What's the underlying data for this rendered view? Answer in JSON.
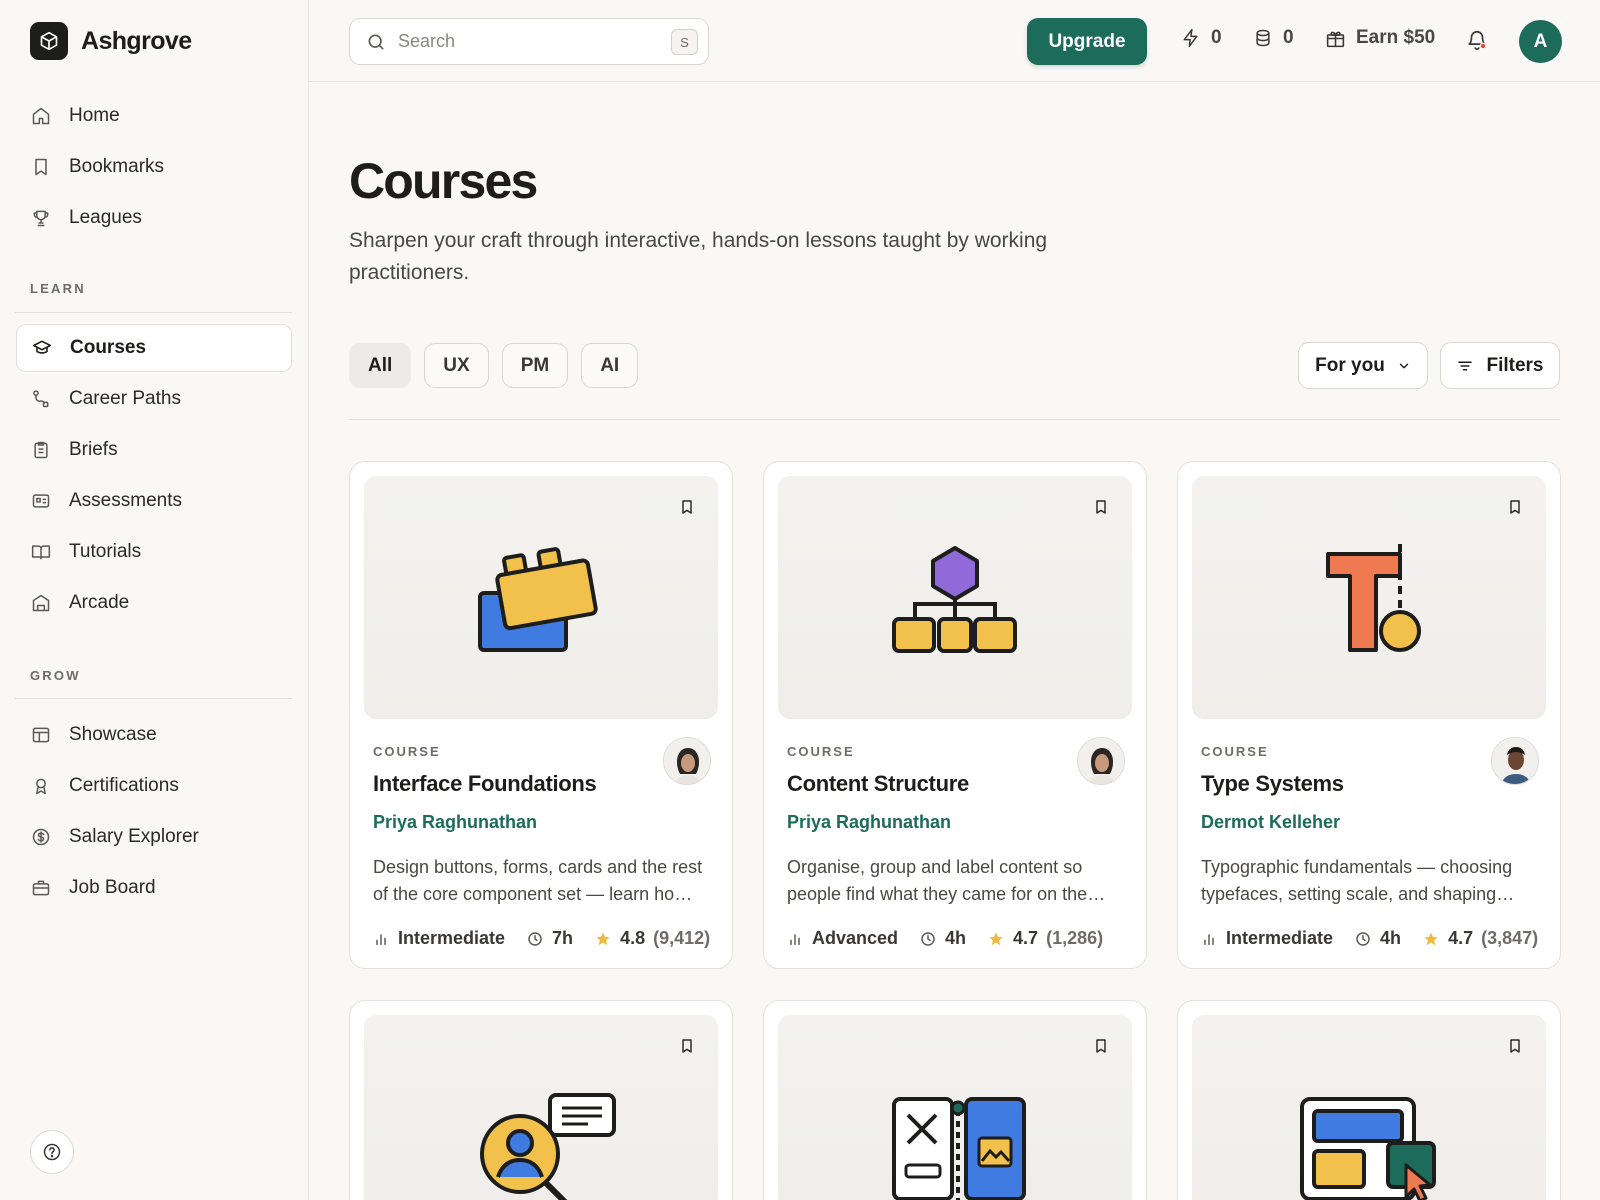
{
  "app": {
    "name": "Ashgrove"
  },
  "sidebar": {
    "primary": [
      {
        "label": "Home",
        "icon": "home-icon"
      },
      {
        "label": "Bookmarks",
        "icon": "bookmark-icon"
      },
      {
        "label": "Leagues",
        "icon": "trophy-icon"
      }
    ],
    "learn_label": "LEARN",
    "learn": [
      {
        "label": "Courses",
        "icon": "graduation-cap-icon",
        "active": true
      },
      {
        "label": "Career Paths",
        "icon": "route-icon"
      },
      {
        "label": "Briefs",
        "icon": "clipboard-icon"
      },
      {
        "label": "Assessments",
        "icon": "id-card-icon"
      },
      {
        "label": "Tutorials",
        "icon": "open-book-icon"
      },
      {
        "label": "Arcade",
        "icon": "arcade-icon"
      }
    ],
    "grow_label": "GROW",
    "grow": [
      {
        "label": "Showcase",
        "icon": "layout-icon"
      },
      {
        "label": "Certifications",
        "icon": "award-icon"
      },
      {
        "label": "Salary Explorer",
        "icon": "dollar-circle-icon"
      },
      {
        "label": "Job Board",
        "icon": "briefcase-icon"
      }
    ]
  },
  "topbar": {
    "search_placeholder": "Search",
    "search_shortcut": "S",
    "upgrade_label": "Upgrade",
    "energy_count": "0",
    "coins_count": "0",
    "earn_label": "Earn $50",
    "avatar_initial": "A"
  },
  "main": {
    "title": "Courses",
    "subtitle": "Sharpen your craft through interactive, hands-on lessons taught by working practitioners.",
    "chips": [
      "All",
      "UX",
      "PM",
      "AI"
    ],
    "active_chip": "All",
    "sort_label": "For you",
    "filters_label": "Filters"
  },
  "courses": [
    {
      "kicker": "COURSE",
      "title": "Interface Foundations",
      "author": "Priya Raghunathan",
      "description": "Design buttons, forms, cards and the rest of the core component set — learn how to build interfaces that feel consistent.",
      "level": "Intermediate",
      "duration": "7h",
      "rating": "4.8",
      "reviews": "(9,412)",
      "illustration": "building-blocks"
    },
    {
      "kicker": "COURSE",
      "title": "Content Structure",
      "author": "Priya Raghunathan",
      "description": "Organise, group and label content so people find what they came for on the first try.",
      "level": "Advanced",
      "duration": "4h",
      "rating": "4.7",
      "reviews": "(1,286)",
      "illustration": "hierarchy"
    },
    {
      "kicker": "COURSE",
      "title": "Type Systems",
      "author": "Dermot Kelleher",
      "description": "Typographic fundamentals — choosing typefaces, setting scale, and shaping readable, expressive text.",
      "level": "Intermediate",
      "duration": "4h",
      "rating": "4.7",
      "reviews": "(3,847)",
      "illustration": "type"
    }
  ],
  "colors": {
    "accent": "#1c6b5b",
    "background": "#f9f8f6",
    "star": "#f2b83a",
    "notification_dot": "#e5483b"
  }
}
